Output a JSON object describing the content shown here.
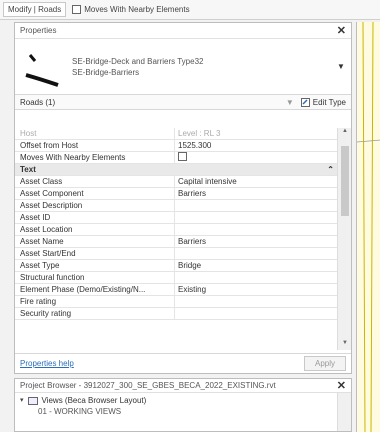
{
  "ribbon": {
    "context_tab": "Modify | Roads",
    "moves_checkbox_label": "Moves With Nearby Elements"
  },
  "properties": {
    "title": "Properties",
    "close_glyph": "✕",
    "type_name_line1": "SE-Bridge-Deck and Barriers Type32",
    "type_name_line2": "SE-Bridge-Barriers",
    "filter_label": "Roads (1)",
    "edit_type_label": "Edit Type",
    "rows": [
      {
        "k": "Host",
        "v": "Level : RL 3",
        "muted": true
      },
      {
        "k": "Offset from Host",
        "v": "1525.300"
      },
      {
        "k": "Moves With Nearby Elements",
        "v": "",
        "checkbox": true
      },
      {
        "group": "Text"
      },
      {
        "k": "Asset Class",
        "v": "Capital intensive"
      },
      {
        "k": "Asset Component",
        "v": "Barriers"
      },
      {
        "k": "Asset Description",
        "v": ""
      },
      {
        "k": "Asset ID",
        "v": ""
      },
      {
        "k": "Asset Location",
        "v": ""
      },
      {
        "k": "Asset Name",
        "v": "Barriers"
      },
      {
        "k": "Asset Start/End",
        "v": ""
      },
      {
        "k": "Asset Type",
        "v": "Bridge"
      },
      {
        "k": "Structural function",
        "v": ""
      },
      {
        "k": "Element Phase (Demo/Existing/N...",
        "v": "Existing"
      },
      {
        "k": "Fire rating",
        "v": ""
      },
      {
        "k": "Security rating",
        "v": ""
      }
    ],
    "help_link": "Properties help",
    "apply_label": "Apply"
  },
  "project_browser": {
    "title": "Project Browser - 3912027_300_SE_GBES_BECA_2022_EXISTING.rvt",
    "close_glyph": "✕",
    "node_views": "Views (Beca Browser Layout)",
    "node_child": "01 - WORKING VIEWS"
  }
}
